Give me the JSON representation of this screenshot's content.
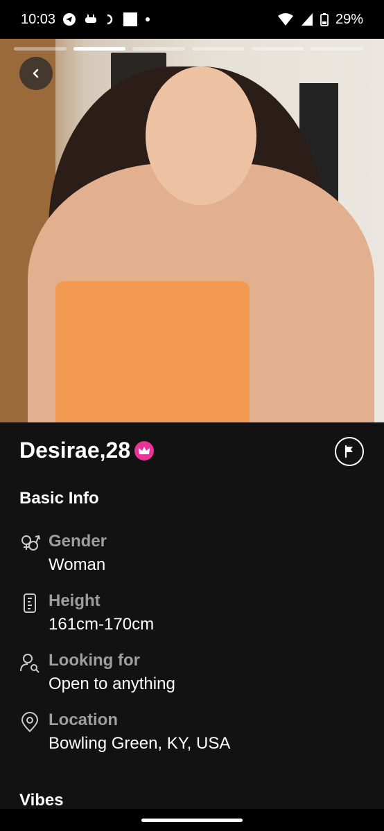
{
  "status": {
    "time": "10:03",
    "battery": "29%"
  },
  "photo": {
    "progress_segments": 6,
    "active_segment": 2
  },
  "profile": {
    "name": "Desirae,",
    "age": "28"
  },
  "basic_info": {
    "title": "Basic Info",
    "items": [
      {
        "icon": "gender-icon",
        "label": "Gender",
        "value": "Woman"
      },
      {
        "icon": "height-icon",
        "label": "Height",
        "value": "161cm-170cm"
      },
      {
        "icon": "looking-for-icon",
        "label": "Looking for",
        "value": "Open to anything"
      },
      {
        "icon": "location-pin-icon",
        "label": "Location",
        "value": "Bowling Green, KY, USA"
      }
    ]
  },
  "vibes": {
    "title": "Vibes"
  },
  "colors": {
    "background": "#121212",
    "accent_pink": "#e8339a",
    "label_gray": "#9e9e9e",
    "status_bar": "#000000"
  }
}
